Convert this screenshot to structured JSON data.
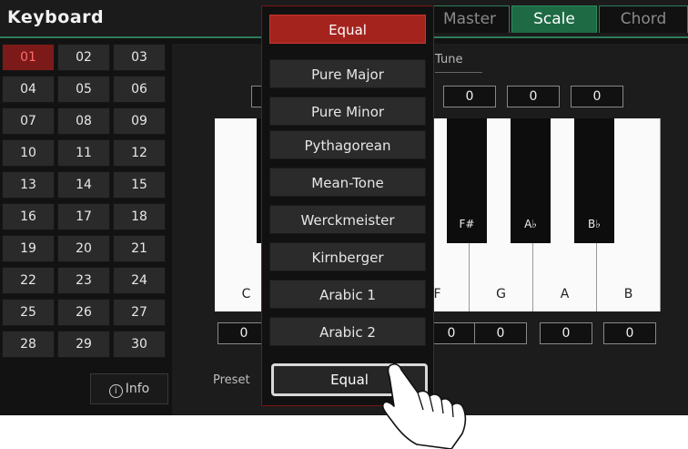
{
  "header": {
    "title": "Keyboard",
    "tabs": [
      {
        "label": "Master",
        "active": false
      },
      {
        "label": "Scale",
        "active": true
      },
      {
        "label": "Chord",
        "active": false
      }
    ]
  },
  "scale_numbers": [
    "01",
    "02",
    "03",
    "04",
    "05",
    "06",
    "07",
    "08",
    "09",
    "10",
    "11",
    "12",
    "13",
    "14",
    "15",
    "16",
    "17",
    "18",
    "19",
    "20",
    "21",
    "22",
    "23",
    "24",
    "25",
    "26",
    "27",
    "28",
    "29",
    "30"
  ],
  "selected_scale_number": "01",
  "info_label": "Info",
  "fine_tune_label": "Tune",
  "top_values": [
    "0",
    "0",
    "0"
  ],
  "bottom_values": [
    "0",
    "0",
    "0",
    "0",
    "0"
  ],
  "white_keys": [
    "C",
    "F",
    "G",
    "A",
    "B"
  ],
  "black_keys": [
    "F#",
    "A♭",
    "B♭"
  ],
  "preset_label": "Preset",
  "preset_value": "Equal",
  "dropdown_options": [
    "Equal",
    "Pure Major",
    "Pure Minor",
    "Pythagorean",
    "Mean-Tone",
    "Werckmeister",
    "Kirnberger",
    "Arabic 1",
    "Arabic 2"
  ],
  "dropdown_selected": "Equal",
  "colors": {
    "accent_green": "#1e6a45",
    "selected_red": "#a5231d",
    "scale_selected": "#7b1a18"
  }
}
